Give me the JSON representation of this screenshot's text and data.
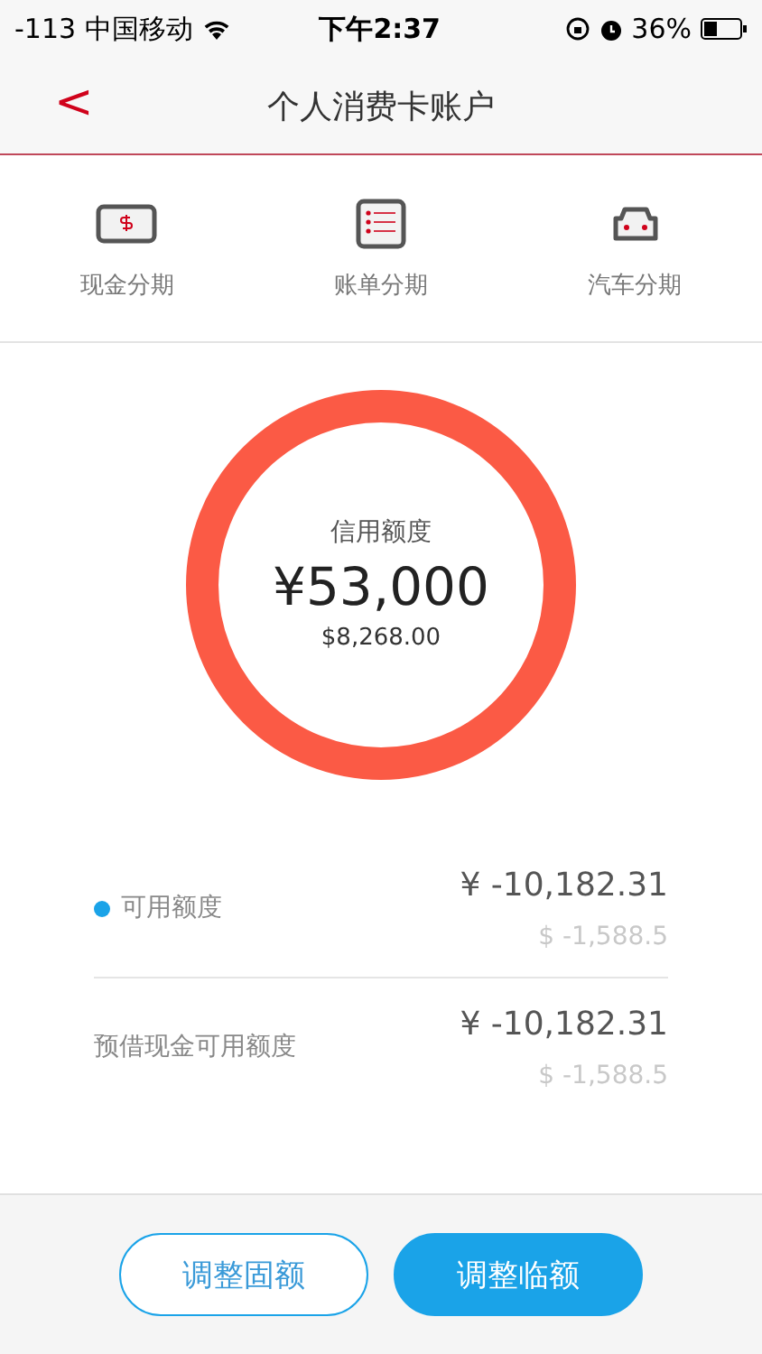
{
  "status_bar": {
    "signal": "-113",
    "carrier": "中国移动",
    "time": "下午2:37",
    "battery": "36%"
  },
  "nav": {
    "back": "<",
    "title": "个人消费卡账户"
  },
  "shortcuts": [
    {
      "kind": "cash",
      "label": "现金分期"
    },
    {
      "kind": "bill",
      "label": "账单分期"
    },
    {
      "kind": "car",
      "label": "汽车分期"
    }
  ],
  "credit": {
    "label": "信用额度",
    "amount": "¥53,000",
    "usd": "$8,268.00"
  },
  "balances": [
    {
      "label": "可用额度",
      "marked": true,
      "cny": "¥ -10,182.31",
      "usd": "$ -1,588.5"
    },
    {
      "label": "预借现金可用额度",
      "marked": false,
      "cny": "¥ -10,182.31",
      "usd": "$ -1,588.5"
    }
  ],
  "buttons": [
    {
      "kind": "outline",
      "label": "调整固额"
    },
    {
      "kind": "filled",
      "label": "调整临额"
    }
  ]
}
